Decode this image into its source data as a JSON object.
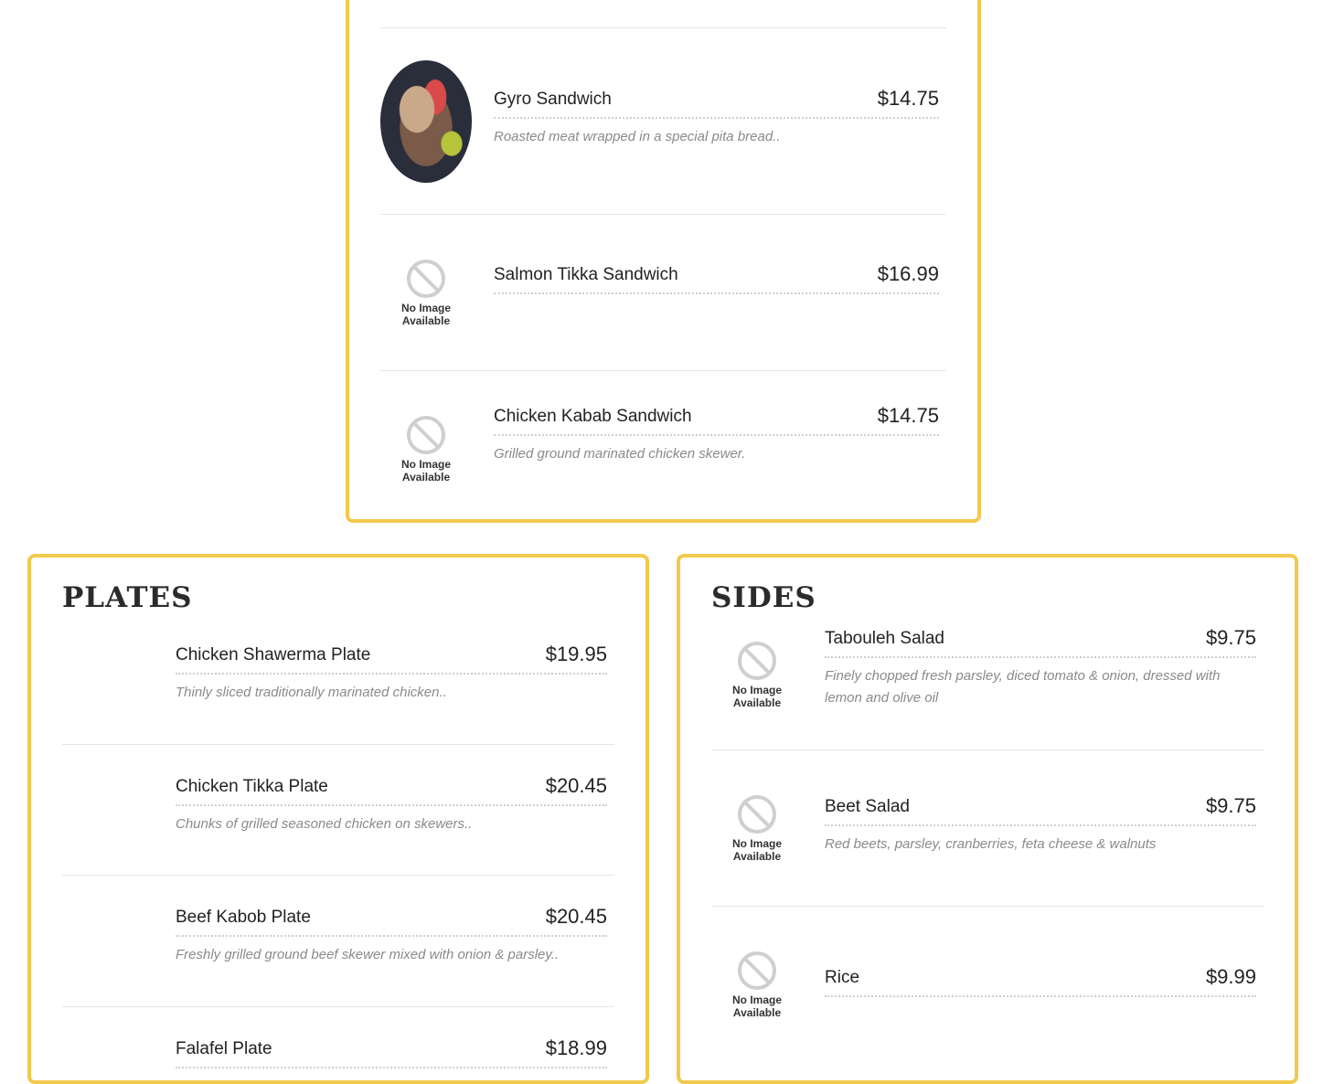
{
  "colors": {
    "card_border": "#f2c94c",
    "price_text": "#222222",
    "desc_text": "#8a8a8a"
  },
  "sandwiches": {
    "items": [
      {
        "name": "Gyro Sandwich",
        "price": "$14.75",
        "description": "Roasted meat wrapped in a special pita bread..",
        "image": "gyro-photo"
      },
      {
        "name": "Salmon Tikka Sandwich",
        "price": "$16.99",
        "description": "",
        "image": "no-image"
      },
      {
        "name": "Chicken Kabab Sandwich",
        "price": "$14.75",
        "description": "Grilled ground marinated chicken skewer.",
        "image": "no-image"
      }
    ]
  },
  "plates": {
    "title": "PLATES",
    "items": [
      {
        "name": "Chicken Shawerma Plate",
        "price": "$19.95",
        "description": "Thinly sliced traditionally marinated chicken.."
      },
      {
        "name": "Chicken Tikka Plate",
        "price": "$20.45",
        "description": "Chunks of grilled seasoned chicken on skewers.."
      },
      {
        "name": "Beef Kabob Plate",
        "price": "$20.45",
        "description": "Freshly grilled ground beef skewer mixed with onion & parsley.."
      },
      {
        "name": "Falafel Plate",
        "price": "$18.99",
        "description": ""
      }
    ]
  },
  "sides": {
    "title": "SIDES",
    "items": [
      {
        "name": "Tabouleh Salad",
        "price": "$9.75",
        "description": "Finely chopped fresh parsley, diced tomato & onion, dressed with lemon and olive oil",
        "image": "no-image"
      },
      {
        "name": "Beet Salad",
        "price": "$9.75",
        "description": "Red beets, parsley, cranberries, feta cheese & walnuts",
        "image": "no-image"
      },
      {
        "name": "Rice",
        "price": "$9.99",
        "description": "",
        "image": "no-image"
      }
    ]
  },
  "no_image_label": {
    "line1": "No Image",
    "line2": "Available"
  }
}
